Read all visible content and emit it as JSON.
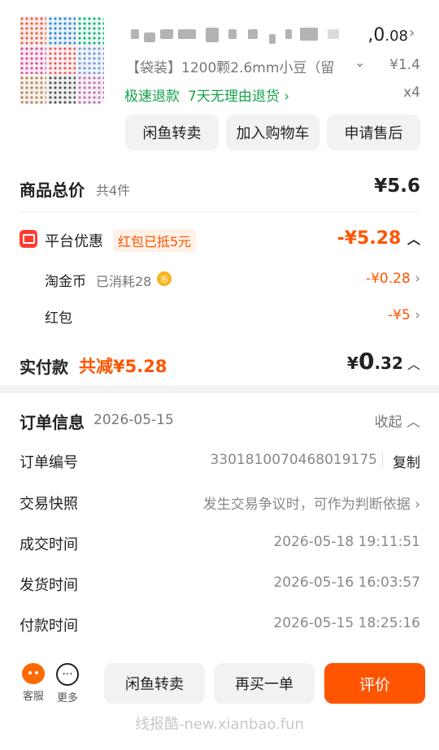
{
  "product": {
    "store_name_redacted": "",
    "price_main_prefix": ",0",
    "price_main_suffix": ".08",
    "description": "【袋装】1200颗2.6mm小豆（留",
    "unit_price": "¥1.4",
    "tags": [
      "极速退款",
      "7天无理由退货"
    ],
    "quantity": "x4"
  },
  "actions": {
    "resell": "闲鱼转卖",
    "add_to_cart": "加入购物车",
    "after_sales": "申请售后"
  },
  "summary": {
    "total_label": "商品总价",
    "total_count": "共4件",
    "total_value": "¥5.6",
    "platform_discount_label": "平台优惠",
    "platform_discount_badge": "红包已抵5元",
    "platform_discount_value": "-¥5.28",
    "taojinbi_label": "淘金币",
    "taojinbi_note": "已消耗28",
    "taojinbi_value": "-¥0.28",
    "hongbao_label": "红包",
    "hongbao_value": "-¥5",
    "paid_label": "实付款",
    "paid_saved": "共减¥5.28",
    "paid_currency": "¥",
    "paid_integer": "0",
    "paid_decimal": ".32"
  },
  "order_info": {
    "title": "订单信息",
    "date": "2026-05-15",
    "collapse": "收起",
    "rows": [
      {
        "label": "订单编号",
        "value": "3301810070468019175",
        "action": "复制"
      },
      {
        "label": "交易快照",
        "value": "发生交易争议时，可作为判断依据"
      },
      {
        "label": "成交时间",
        "value": "2026-05-18 19:11:51"
      },
      {
        "label": "发货时间",
        "value": "2026-05-16 16:03:57"
      },
      {
        "label": "付款时间",
        "value": "2026-05-15 18:25:16"
      }
    ]
  },
  "bottom": {
    "service": "客服",
    "more": "更多",
    "resell": "闲鱼转卖",
    "rebuy": "再买一单",
    "review": "评价",
    "watermark": "线报酷-new.xianbao.fun"
  },
  "colors": {
    "accent": "#ff5500",
    "green": "#16a34a",
    "discount_red": "#ff3b30"
  }
}
